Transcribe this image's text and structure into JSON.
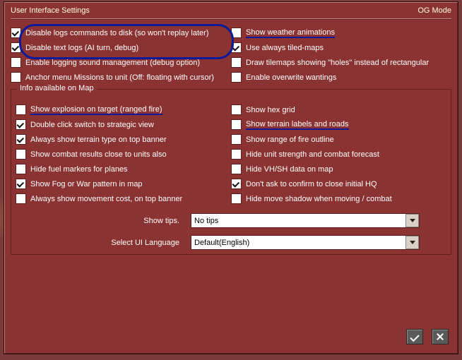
{
  "title": "User Interface Settings",
  "mode_label": "OG Mode",
  "top_left": [
    {
      "checked": true,
      "label": "Disable logs commands to disk (so won't replay later)",
      "circled": true
    },
    {
      "checked": true,
      "label": "Disable text logs (AI turn, debug)",
      "circled": true
    },
    {
      "checked": false,
      "label": "Enable logging sound management (debug option)"
    },
    {
      "checked": false,
      "label": "Anchor menu Missions to unit (Off: floating with cursor)"
    }
  ],
  "top_right": [
    {
      "checked": false,
      "label": "Show weather animations",
      "underlined": true
    },
    {
      "checked": true,
      "label": "Use always tiled-maps"
    },
    {
      "checked": false,
      "label": "Draw tilemaps showing \"holes\" instead of rectangular"
    },
    {
      "checked": false,
      "label": "Enable overwrite wantings"
    }
  ],
  "fieldset_legend": "Info available on Map",
  "map_left": [
    {
      "checked": false,
      "label": "Show explosion on target (ranged fire)",
      "underlined": true
    },
    {
      "checked": true,
      "label": "Double click switch to strategic view"
    },
    {
      "checked": true,
      "label": "Always show terrain type on top banner"
    },
    {
      "checked": false,
      "label": "Show combat results close to units also"
    },
    {
      "checked": false,
      "label": "Hide fuel markers for planes"
    },
    {
      "checked": true,
      "label": "Show Fog or War pattern in map"
    },
    {
      "checked": false,
      "label": "Always show movement cost, on top banner"
    }
  ],
  "map_right": [
    {
      "checked": false,
      "label": "Show hex grid"
    },
    {
      "checked": false,
      "label": "Show terrain labels and roads",
      "underlined": true
    },
    {
      "checked": false,
      "label": "Show range of fire outline"
    },
    {
      "checked": false,
      "label": "Hide unit strength and combat forecast"
    },
    {
      "checked": false,
      "label": "Hide VH/SH data on map"
    },
    {
      "checked": true,
      "label": "Don't ask to confirm to close initial HQ"
    },
    {
      "checked": false,
      "label": "Hide move shadow when moving / combat"
    }
  ],
  "show_tips_label": "Show tips.",
  "show_tips_value": "No tips",
  "lang_label": "Select UI Language",
  "lang_value": "Default(English)"
}
